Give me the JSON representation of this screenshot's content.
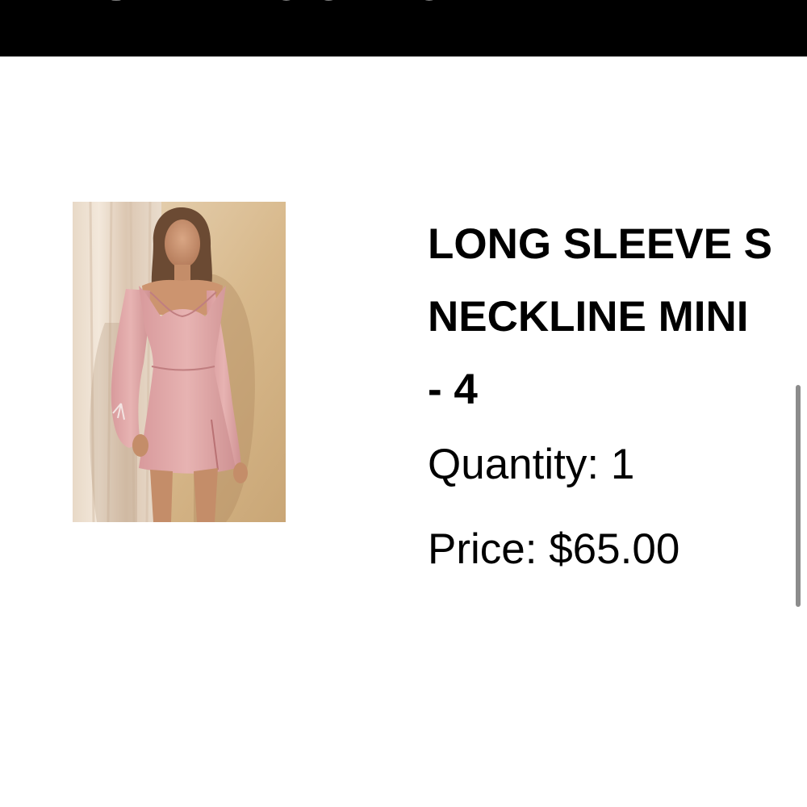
{
  "header": {
    "title": "ITEMS IN YOUR ORDER"
  },
  "order_item": {
    "image_alt": "Woman wearing pink long sleeve mini dress",
    "name_lines": [
      "LONG SLEEVE S",
      "NECKLINE MINI",
      "- 4"
    ],
    "quantity_text": "Quantity: 1",
    "price_text": "Price: $65.00"
  },
  "colors": {
    "banner": "#000000",
    "background": "#ffffff",
    "dress_pink": "#dca7a8",
    "scrollbar": "#8c8c8c"
  },
  "icons": {
    "scrollbar": "vertical-scroll-indicator"
  }
}
